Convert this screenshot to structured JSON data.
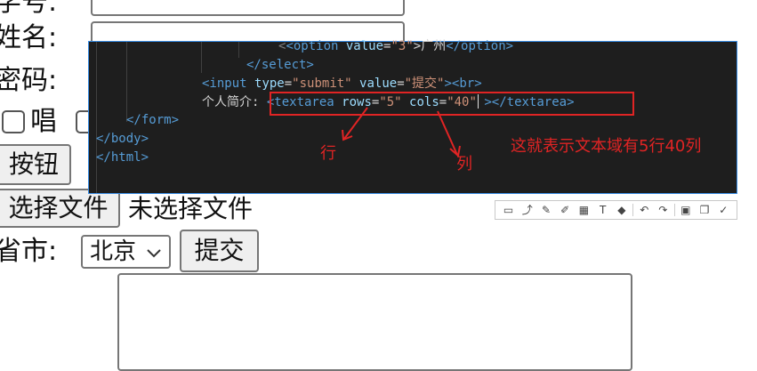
{
  "form": {
    "label_id": "学号:",
    "label_name": "姓名:",
    "label_password": "密码:",
    "checkbox_label_sing": "唱",
    "button_label": "按钮",
    "file_button_label": "选择文件",
    "file_status": "未选择文件",
    "label_city": "省市:",
    "city_selected": "北京",
    "submit_label": "提交"
  },
  "editor": {
    "line1_tag_open": "<option ",
    "line1_attr": "value",
    "line1_eq": "=",
    "line1_value": "\"3\"",
    "line1_text": ">广州",
    "line1_tag_close": "</option>",
    "line2": "</select>",
    "line3_tag_open": "<input ",
    "line3_attr1": "type",
    "line3_value1": "\"submit\"",
    "line3_attr2": " value",
    "line3_value2": "\"提交\"",
    "line3_tail": "><br>",
    "line4_text": "个人简介: ",
    "line4_tag_open": "<textarea ",
    "line4_attr1": "rows",
    "line4_value1": "\"5\"",
    "line4_attr2": " cols",
    "line4_value2": "\"40\"",
    "line4_tail": " ></textarea>",
    "line5": "</form>",
    "line6": "</body>",
    "line7": "</html>"
  },
  "annotations": {
    "row_label": "行",
    "col_label": "列",
    "explain": "这就表示文本域有5行40列"
  },
  "toolbar": {
    "tools": [
      "rect-icon",
      "line-icon",
      "pen-icon",
      "marker-icon",
      "mosaic-icon",
      "text-icon",
      "eraser-icon",
      "undo-icon",
      "redo-icon",
      "save-icon",
      "copy-icon",
      "confirm-icon"
    ]
  },
  "colors": {
    "editor_bg": "#1e1e1e",
    "tag": "#569cd6",
    "attr": "#9cdcfe",
    "string": "#ce9178",
    "annotation": "#e02424"
  }
}
